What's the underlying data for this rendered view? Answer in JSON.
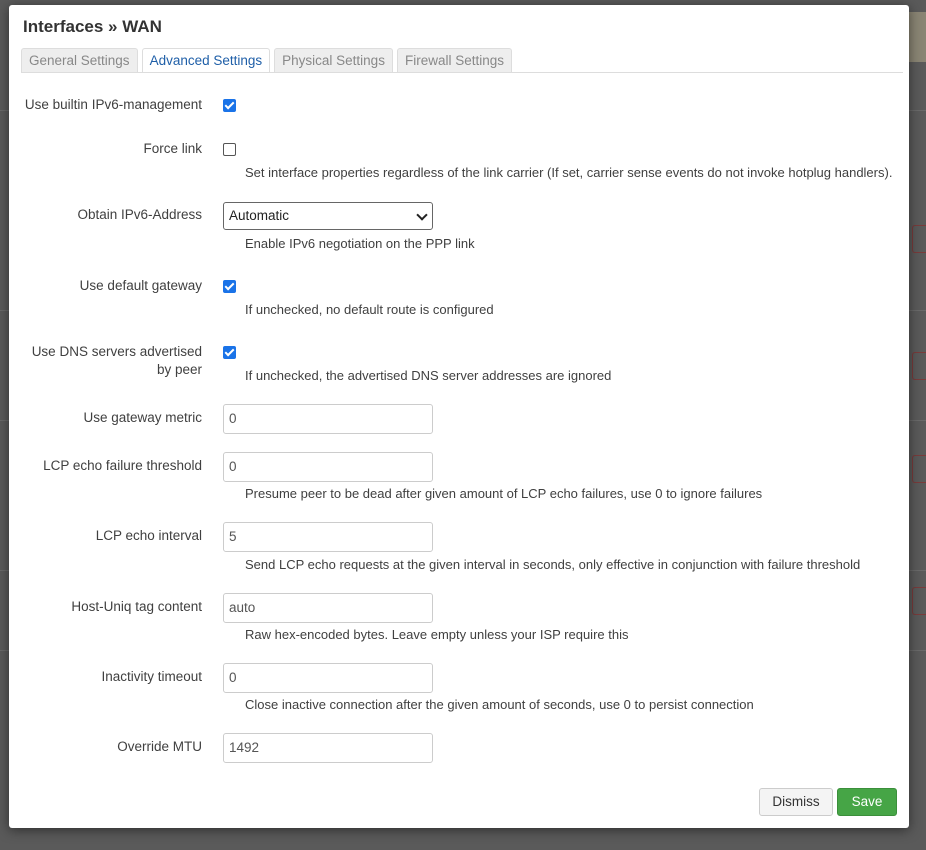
{
  "modal": {
    "title": "Interfaces » WAN",
    "tabs": [
      {
        "label": "General Settings",
        "active": false
      },
      {
        "label": "Advanced Settings",
        "active": true
      },
      {
        "label": "Physical Settings",
        "active": false
      },
      {
        "label": "Firewall Settings",
        "active": false
      }
    ],
    "fields": {
      "ipv6_mgmt": {
        "label": "Use builtin IPv6-management",
        "checked": true
      },
      "force_link": {
        "label": "Force link",
        "checked": false,
        "help": "Set interface properties regardless of the link carrier (If set, carrier sense events do not invoke hotplug handlers)."
      },
      "obtain_ipv6": {
        "label": "Obtain IPv6-Address",
        "value": "Automatic",
        "help": "Enable IPv6 negotiation on the PPP link"
      },
      "default_gw": {
        "label": "Use default gateway",
        "checked": true,
        "help": "If unchecked, no default route is configured"
      },
      "peer_dns": {
        "label_line1": "Use DNS servers advertised",
        "label_line2": "by peer",
        "checked": true,
        "help": "If unchecked, the advertised DNS server addresses are ignored"
      },
      "gw_metric": {
        "label": "Use gateway metric",
        "placeholder": "0"
      },
      "lcp_threshold": {
        "label": "LCP echo failure threshold",
        "placeholder": "0",
        "help": "Presume peer to be dead after given amount of LCP echo failures, use 0 to ignore failures"
      },
      "lcp_interval": {
        "label": "LCP echo interval",
        "placeholder": "5",
        "help": "Send LCP echo requests at the given interval in seconds, only effective in conjunction with failure threshold"
      },
      "host_uniq": {
        "label": "Host-Uniq tag content",
        "placeholder": "auto",
        "help": "Raw hex-encoded bytes. Leave empty unless your ISP require this"
      },
      "inactivity": {
        "label": "Inactivity timeout",
        "placeholder": "0",
        "help": "Close inactive connection after the given amount of seconds, use 0 to persist connection"
      },
      "mtu": {
        "label": "Override MTU",
        "placeholder": "1492"
      }
    },
    "buttons": {
      "dismiss": "Dismiss",
      "save": "Save"
    }
  },
  "colors": {
    "accent": "#1a73e8",
    "save": "#46a546",
    "tab_active_text": "#1f5fa8"
  }
}
